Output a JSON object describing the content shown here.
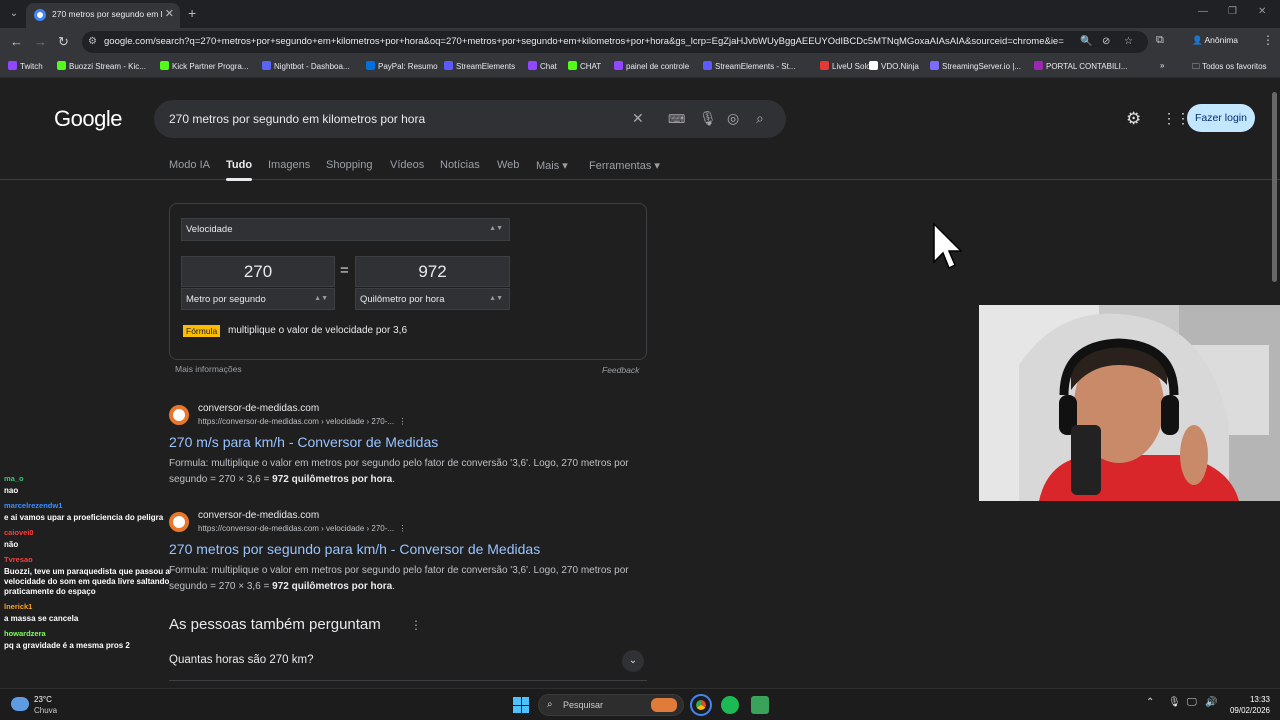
{
  "browser": {
    "tab_title": "270 metros por segundo em k",
    "url": "google.com/search?q=270+metros+por+segundo+em+kilometros+por+hora&oq=270+metros+por+segundo+em+kilometros+por+hora&gs_lcrp=EgZjaHJvbWUyBggAEEUYOdIBCDc5MTNqMGoxaAIAsAIA&sourceid=chrome&ie=...",
    "profile_label": "Anônima",
    "bookmarks": [
      {
        "label": "Twitch",
        "color": "#9146ff"
      },
      {
        "label": "Buozzi Stream - Kic...",
        "color": "#53fc18"
      },
      {
        "label": "Kick Partner Progra...",
        "color": "#53fc18"
      },
      {
        "label": "Nightbot - Dashboa...",
        "color": "#5865f2"
      },
      {
        "label": "PayPal: Resumo",
        "color": "#0070e0"
      },
      {
        "label": "StreamElements",
        "color": "#5a5aff"
      },
      {
        "label": "Chat",
        "color": "#9146ff"
      },
      {
        "label": "CHAT",
        "color": "#53fc18"
      },
      {
        "label": "painel de controle",
        "color": "#9146ff"
      },
      {
        "label": "StreamElements - St...",
        "color": "#5a5aff"
      },
      {
        "label": "LiveU Solo",
        "color": "#e53935"
      },
      {
        "label": "VDO.Ninja",
        "color": "#ffffff"
      },
      {
        "label": "StreamingServer.io |...",
        "color": "#7b6cff"
      },
      {
        "label": "PORTAL CONTABILI...",
        "color": "#9c27b0"
      }
    ],
    "all_bookmarks": "Todos os favoritos"
  },
  "google": {
    "logo": "Google",
    "query": "270 metros por segundo em kilometros por hora",
    "login": "Fazer login",
    "tabs": [
      "Modo IA",
      "Tudo",
      "Imagens",
      "Shopping",
      "Vídeos",
      "Notícias",
      "Web",
      "Mais",
      "Ferramentas"
    ],
    "active_tab": "Tudo"
  },
  "converter": {
    "category": "Velocidade",
    "from_value": "270",
    "to_value": "972",
    "from_unit": "Metro por segundo",
    "to_unit": "Quilômetro por hora",
    "formula_label": "Fórmula",
    "formula_text": "multiplique o valor de velocidade por 3,6",
    "more_info": "Mais informações",
    "feedback": "Feedback"
  },
  "results": [
    {
      "site": "conversor-de-medidas.com",
      "url": "https://conversor-de-medidas.com › velocidade › 270-...",
      "title": "270 m/s para km/h - Conversor de Medidas",
      "snippet_1": "Formula: multiplique o valor em metros por segundo pelo fator de conversão '3,6'. Logo, 270 metros por segundo = 270 × 3,6 = ",
      "snippet_bold": "972 quilômetros por hora",
      "snippet_2": "."
    },
    {
      "site": "conversor-de-medidas.com",
      "url": "https://conversor-de-medidas.com › velocidade › 270-...",
      "title": "270 metros por segundo para km/h - Conversor de Medidas",
      "snippet_1": "Formula: multiplique o valor em metros por segundo pelo fator de conversão '3,6'. Logo, 270 metros por segundo = 270 × 3,6 = ",
      "snippet_bold": "972 quilômetros por hora",
      "snippet_2": "."
    }
  ],
  "paa": {
    "title": "As pessoas também perguntam",
    "question": "Quantas horas são 270 km?"
  },
  "chat": [
    {
      "user": "ma_o",
      "color": "#2ecc71",
      "msg": "nao"
    },
    {
      "user": "marcelrezendw1",
      "color": "#3a8dff",
      "msg": "e ai vamos upar a proeficiencia do peligra"
    },
    {
      "user": "caiovei0",
      "color": "#ff3b3b",
      "msg": "não"
    },
    {
      "user": "Tvresao",
      "color": "#ff3b3b",
      "msg": "Buozzi, teve um paraquedista que passou a velocidade do som em queda livre saltando praticamente do espaço"
    },
    {
      "user": "lnerick1",
      "color": "#ff9f1a",
      "msg": "a massa se cancela"
    },
    {
      "user": "howardzera",
      "color": "#7dff5a",
      "msg": "pq a gravidade é a mesma pros 2"
    }
  ],
  "taskbar": {
    "temp": "23°C",
    "weather": "Chuva",
    "search_placeholder": "Pesquisar",
    "time": "13:33",
    "date": "09/02/2026"
  }
}
